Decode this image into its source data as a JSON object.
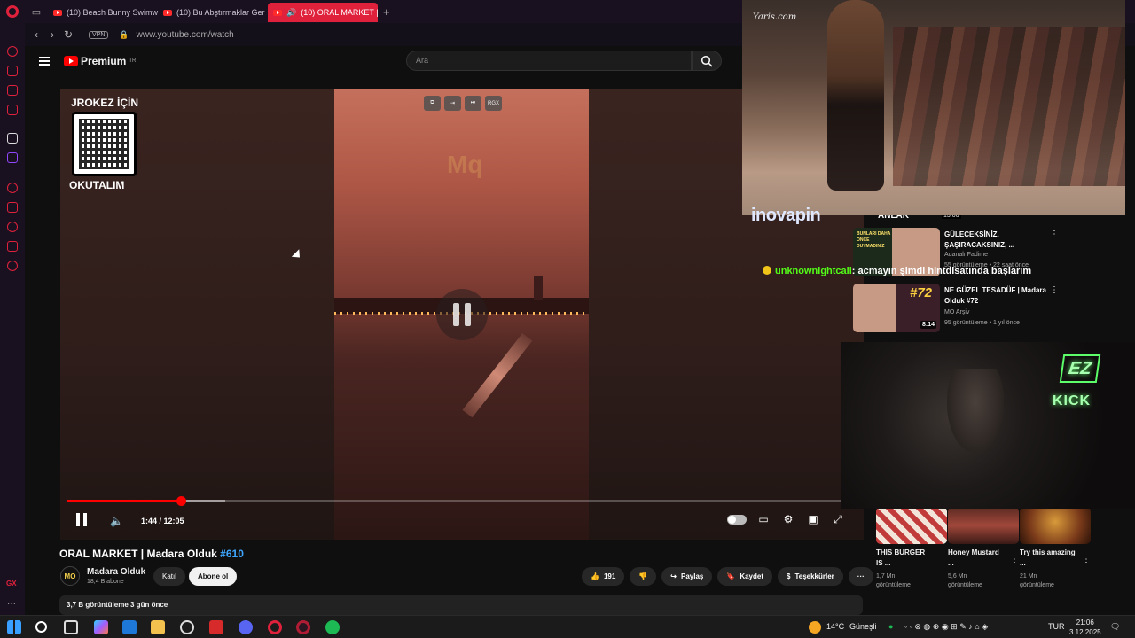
{
  "browser": {
    "tabs": [
      {
        "label": "(10) Beach Bunny Swimw"
      },
      {
        "label": "(10) Bu Abştırmaklar Ger"
      },
      {
        "label": "(10) ORAL MARKET | M"
      }
    ],
    "vpn_label": "VPN",
    "url": "www.youtube.com/watch",
    "sidebar_gx": "GX"
  },
  "youtube": {
    "logo_text": "Premium",
    "logo_sup": "TR",
    "search_placeholder": "Ara",
    "video": {
      "qr_top": "JROKEZ İÇİN",
      "qr_bottom": "OKUTALIM",
      "watermark": "Mq",
      "mini_ctrl_label": "RGX",
      "current_time": "1:44 / 12:05",
      "played_fraction": 0.144,
      "loaded_fraction": 0.2
    },
    "title": "ORAL MARKET | Madara Olduk",
    "title_hashtag": "#610",
    "channel": {
      "avatar": "MO",
      "name": "Madara Olduk",
      "subs": "18,4 B abone"
    },
    "join_label": "Katıl",
    "subscribe_label": "Abone ol",
    "actions": {
      "likes": "191",
      "share": "Paylaş",
      "save": "Kaydet",
      "thanks": "Teşekkürler"
    },
    "desc": "3,7 B görüntüleme  3 gün önce",
    "recommendations": [
      {
        "title": "GÜLECEKSİNİZ, ŞAŞIRACAKSINIZ, ...",
        "channel": "Adanalı Fadime",
        "meta": "55 görüntüleme • 22 saat önce",
        "thumb_text": "BUNLARI DAHA ÖNCE DUYMADINIZ",
        "duration": ""
      },
      {
        "title": "NE GÜZEL TESADÜF | Madara Olduk #72",
        "channel": "MO Arşiv",
        "meta": "95 görüntüleme • 1 yıl önce",
        "thumb_text": "#72",
        "duration": "8:14"
      }
    ],
    "rec_top_partial": "ANLAK",
    "rec_top_partial_dur": "13:06",
    "shorts": [
      {
        "title": "THIS BURGER IS ...",
        "views": "1,7 Mn görüntüleme"
      },
      {
        "title": "Honey Mustard ...",
        "views": "5,6 Mn görüntüleme"
      },
      {
        "title": "Try this amazing ...",
        "views": "21 Mn görüntüleme"
      }
    ]
  },
  "stream": {
    "runway_watermark": "Yaris.com",
    "ad_logo": "inovapin",
    "chat_user": "unknownightcall",
    "chat_msg": ": acmayın şimdi hintdisatında başlarım",
    "ez_text": "EZ",
    "kick_text": "KICK"
  },
  "taskbar": {
    "weather": "14°C",
    "weather_desc": "Güneşli",
    "lang": "TUR",
    "time": "21:06",
    "date": "3.12.2025"
  },
  "colors": {
    "opera_red": "#e0213c",
    "yt_red": "#ff0000",
    "kick_green": "#53fc18"
  }
}
